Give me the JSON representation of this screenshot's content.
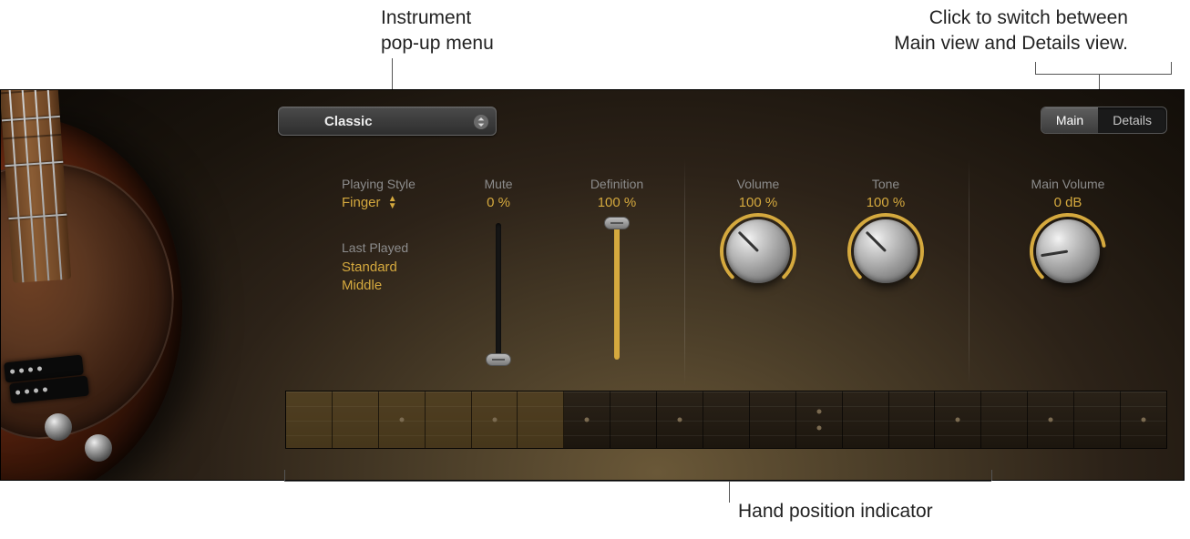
{
  "callouts": {
    "instrument_popup": "Instrument\npop-up menu",
    "view_switch": "Click to switch between\nMain view and Details view.",
    "hand_position": "Hand position indicator"
  },
  "instrument_popup": {
    "selected": "Classic"
  },
  "view_switch": {
    "main": "Main",
    "details": "Details",
    "active": "main"
  },
  "params": {
    "playing_style": {
      "label": "Playing Style",
      "value": "Finger"
    },
    "last_played": {
      "label": "Last Played",
      "value": "Standard\nMiddle"
    },
    "mute": {
      "label": "Mute",
      "value": "0 %",
      "pct": 0
    },
    "definition": {
      "label": "Definition",
      "value": "100 %",
      "pct": 100
    },
    "volume": {
      "label": "Volume",
      "value": "100 %",
      "pct": 100
    },
    "tone": {
      "label": "Tone",
      "value": "100 %",
      "pct": 100
    },
    "main_volume": {
      "label": "Main Volume",
      "value": "0 dB",
      "pct": 80
    }
  },
  "fretboard": {
    "total_frets": 19,
    "highlight_start": 0,
    "highlight_end": 5,
    "single_dots": [
      2,
      4,
      6,
      8,
      14,
      16,
      18
    ],
    "double_dots": [
      11
    ]
  }
}
